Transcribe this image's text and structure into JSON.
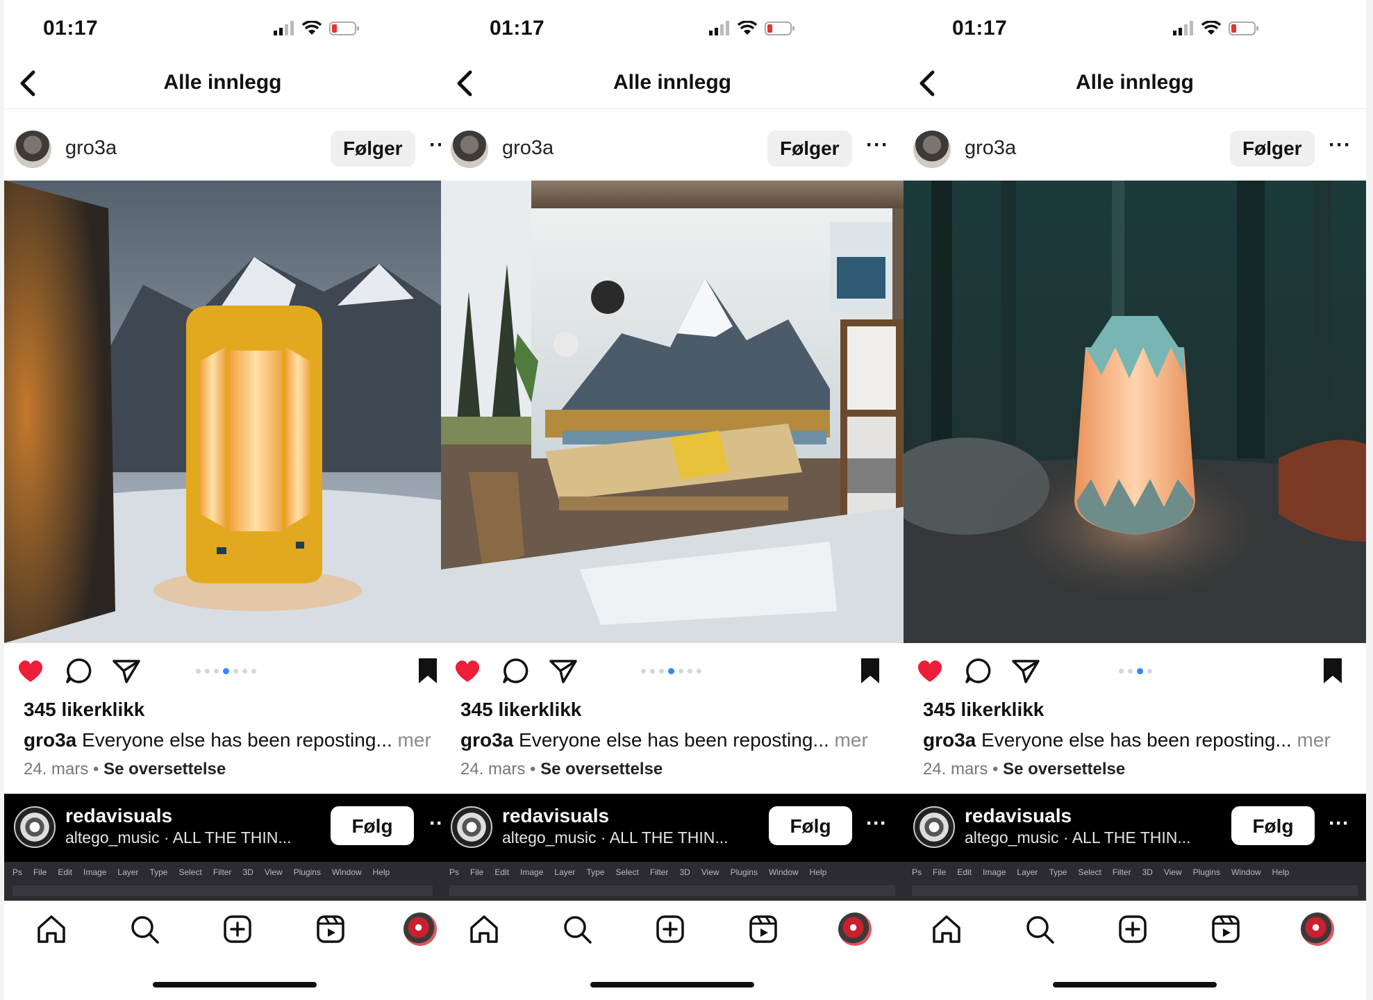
{
  "panels": [
    {
      "status": {
        "time": "01:17"
      },
      "nav": {
        "title": "Alle innlegg"
      },
      "post": {
        "username": "gro3a",
        "follow_label": "Følger",
        "more_label": "··",
        "likes": "345 likerklikk",
        "caption_user": "gro3a",
        "caption_text": " Everyone else has been reposting... ",
        "caption_more": "mer",
        "date": "24. mars",
        "sep": " • ",
        "translate": "Se oversettelse"
      },
      "next": {
        "username": "redavisuals",
        "subtitle": "altego_music · ALL THE THIN...",
        "follow_label": "Følg",
        "more_label": "··"
      },
      "ps_menu": [
        "Ps",
        "File",
        "Edit",
        "Image",
        "Layer",
        "Type",
        "Select",
        "Filter",
        "3D",
        "View",
        "Plugins",
        "Window",
        "Help"
      ]
    },
    {
      "status": {
        "time": "01:17"
      },
      "nav": {
        "title": "Alle innlegg"
      },
      "post": {
        "username": "gro3a",
        "follow_label": "Følger",
        "more_label": "···",
        "likes": "345 likerklikk",
        "caption_user": "gro3a",
        "caption_text": " Everyone else has been reposting... ",
        "caption_more": "mer",
        "date": "24. mars",
        "sep": " • ",
        "translate": "Se oversettelse"
      },
      "next": {
        "username": "redavisuals",
        "subtitle": "altego_music · ALL THE THIN...",
        "follow_label": "Følg",
        "more_label": "···"
      },
      "ps_menu": [
        "Ps",
        "File",
        "Edit",
        "Image",
        "Layer",
        "Type",
        "Select",
        "Filter",
        "3D",
        "View",
        "Plugins",
        "Window",
        "Help"
      ]
    },
    {
      "status": {
        "time": "01:17"
      },
      "nav": {
        "title": "Alle innlegg"
      },
      "post": {
        "username": "gro3a",
        "follow_label": "Følger",
        "more_label": "···",
        "likes": "345 likerklikk",
        "caption_user": "gro3a",
        "caption_text": " Everyone else has been reposting... ",
        "caption_more": "mer",
        "date": "24. mars",
        "sep": " • ",
        "translate": "Se oversettelse"
      },
      "next": {
        "username": "redavisuals",
        "subtitle": "altego_music · ALL THE THIN...",
        "follow_label": "Følg",
        "more_label": "···"
      },
      "ps_menu": [
        "Ps",
        "File",
        "Edit",
        "Image",
        "Layer",
        "Type",
        "Select",
        "Filter",
        "3D",
        "View",
        "Plugins",
        "Window",
        "Help"
      ]
    }
  ],
  "carousel": [
    {
      "count": 7,
      "active": 4
    },
    {
      "count": 7,
      "active": 4
    },
    {
      "count": 4,
      "active": 3
    }
  ],
  "photos": [
    "yellow-lantern-snow-mountains",
    "mountain-cabin-interior-bench",
    "glowing-lantern-dark-forest"
  ],
  "colors": {
    "like_red": "#ee1d3a",
    "dot_active": "#2f8bf5",
    "battery_low": "#e8332f"
  },
  "icons": {
    "status": [
      "signal-icon",
      "wifi-icon",
      "battery-icon"
    ],
    "actions": [
      "heart-icon",
      "comment-icon",
      "share-icon",
      "bookmark-icon"
    ],
    "tabs": [
      "home-icon",
      "search-icon",
      "create-icon",
      "reels-icon",
      "profile-avatar-icon"
    ]
  }
}
